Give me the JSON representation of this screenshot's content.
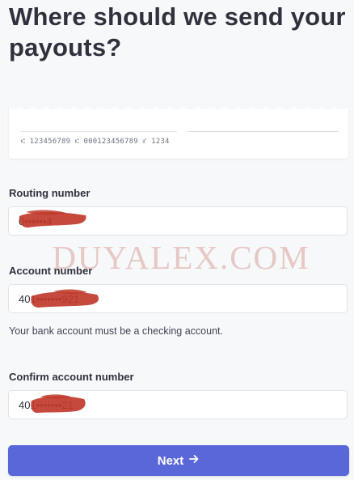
{
  "page": {
    "title": "Where should we send your payouts?"
  },
  "check_illustration": {
    "routing_sample": "123456789",
    "account_sample": "000123456789",
    "check_number_sample": "1234",
    "sym_transit": "⑆",
    "sym_on_us": "⑈"
  },
  "form": {
    "routing": {
      "label": "Routing number",
      "value": "0••••••4"
    },
    "account": {
      "label": "Account number",
      "value": "401•••••••921",
      "help": "Your bank account must be a checking account."
    },
    "confirm": {
      "label": "Confirm account number",
      "value": "401•••••••21"
    }
  },
  "actions": {
    "next_label": "Next",
    "next_icon": "arrow-right-icon"
  },
  "watermark": {
    "text": "DUYALEX.COM"
  },
  "colors": {
    "primary": "#5a67d8",
    "background": "#f6f8fa",
    "redaction": "#c0392b",
    "watermark": "#d08070"
  }
}
